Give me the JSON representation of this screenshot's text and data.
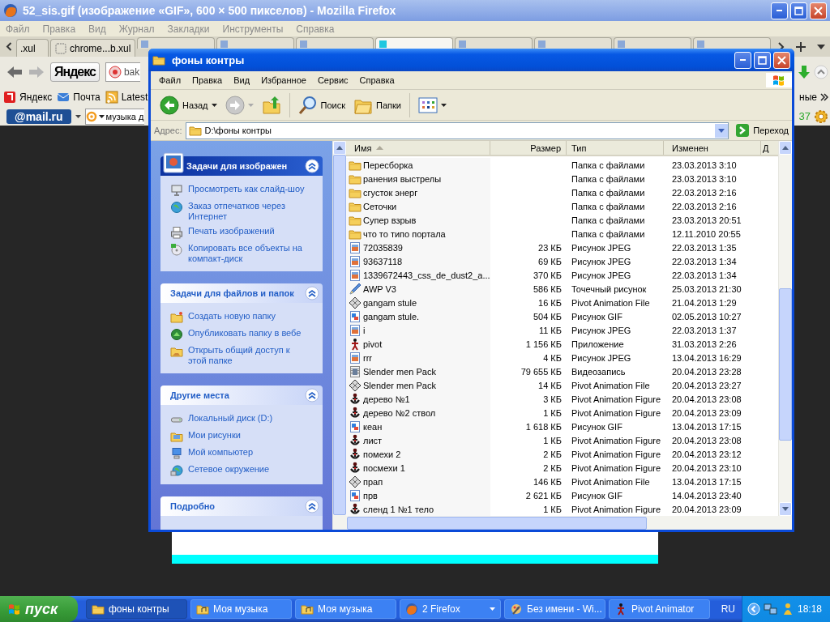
{
  "browser": {
    "title": "52_sis.gif (изображение «GIF», 600 × 500 пикселов) - Mozilla Firefox",
    "menu": [
      "Файл",
      "Правка",
      "Вид",
      "Журнал",
      "Закладки",
      "Инструменты",
      "Справка"
    ],
    "tabs": [
      {
        "label": ".xul",
        "selected": false
      },
      {
        "label": "chrome...b.xul",
        "selected": false
      },
      {
        "selected": false
      },
      {
        "selected": false
      },
      {
        "selected": false
      },
      {
        "selected": true
      },
      {
        "selected": false
      },
      {
        "selected": false
      },
      {
        "selected": false
      },
      {
        "selected": false
      }
    ],
    "search_button": "Яндекс",
    "address": "bak",
    "bookmarks": [
      "Яндекс",
      "Почта",
      "Latest"
    ],
    "bookmarks_overflow": "ные",
    "mail_logo": "@mail.ru",
    "mail_search": "музыка д",
    "counter": "37"
  },
  "explorer": {
    "title": "фоны контры",
    "menu": [
      "Файл",
      "Правка",
      "Вид",
      "Избранное",
      "Сервис",
      "Справка"
    ],
    "toolbar": {
      "back": "Назад",
      "search": "Поиск",
      "folders": "Папки"
    },
    "address_label": "Адрес:",
    "address": "D:\\фоны контры",
    "go": "Переход",
    "task_panes": [
      {
        "kind": "primary",
        "title": "Задачи для изображен",
        "expanded": true,
        "links": [
          "Просмотреть как слайд-шоу",
          "Заказ отпечатков через Интернет",
          "Печать изображений",
          "Копировать все объекты на компакт-диск"
        ]
      },
      {
        "kind": "normal",
        "title": "Задачи для файлов и папок",
        "expanded": true,
        "links": [
          "Создать новую папку",
          "Опубликовать папку в вебе",
          "Открыть общий доступ к этой папке"
        ]
      },
      {
        "kind": "normal",
        "title": "Другие места",
        "expanded": true,
        "links": [
          "Локальный диск (D:)",
          "Мои рисунки",
          "Мой компьютер",
          "Сетевое окружение"
        ]
      },
      {
        "kind": "normal",
        "title": "Подробно",
        "expanded": true
      }
    ],
    "columns": [
      "Имя",
      "Размер",
      "Тип",
      "Изменен",
      "Д"
    ],
    "files": [
      {
        "kind": "folder",
        "name": "Пересборка",
        "type": "Папка с файлами",
        "modified": "23.03.2013 3:10"
      },
      {
        "kind": "folder",
        "name": "ранения выстрелы",
        "type": "Папка с файлами",
        "modified": "23.03.2013 3:10"
      },
      {
        "kind": "folder",
        "name": "сгусток энерг",
        "type": "Папка с файлами",
        "modified": "22.03.2013 2:16"
      },
      {
        "kind": "folder",
        "name": "Сеточки",
        "type": "Папка с файлами",
        "modified": "22.03.2013 2:16"
      },
      {
        "kind": "folder",
        "name": "Супер взрыв",
        "type": "Папка с файлами",
        "modified": "23.03.2013 20:51"
      },
      {
        "kind": "folder",
        "name": "что то типо портала",
        "type": "Папка с файлами",
        "modified": "12.11.2010 20:55"
      },
      {
        "kind": "jpeg",
        "name": "72035839",
        "size": "23 КБ",
        "type": "Рисунок JPEG",
        "modified": "22.03.2013 1:35"
      },
      {
        "kind": "jpeg",
        "name": "93637118",
        "size": "69 КБ",
        "type": "Рисунок JPEG",
        "modified": "22.03.2013 1:34"
      },
      {
        "kind": "jpeg",
        "name": "1339672443_css_de_dust2_a...",
        "size": "370 КБ",
        "type": "Рисунок JPEG",
        "modified": "22.03.2013 1:34"
      },
      {
        "kind": "bitmap",
        "name": "AWP V3",
        "size": "586 КБ",
        "type": "Точечный рисунок",
        "modified": "25.03.2013 21:30"
      },
      {
        "kind": "pivot-file",
        "name": "gangam stule",
        "size": "16 КБ",
        "type": "Pivot Animation File",
        "modified": "21.04.2013 1:29"
      },
      {
        "kind": "gif",
        "name": "gangam stule.",
        "size": "504 КБ",
        "type": "Рисунок GIF",
        "modified": "02.05.2013 10:27"
      },
      {
        "kind": "jpeg",
        "name": "i",
        "size": "11 КБ",
        "type": "Рисунок JPEG",
        "modified": "22.03.2013 1:37"
      },
      {
        "kind": "application",
        "name": "pivot",
        "size": "1 156 КБ",
        "type": "Приложение",
        "modified": "31.03.2013 2:26"
      },
      {
        "kind": "jpeg",
        "name": "rrr",
        "size": "4 КБ",
        "type": "Рисунок JPEG",
        "modified": "13.04.2013 16:29"
      },
      {
        "kind": "video",
        "name": "Slender men Pack",
        "size": "79 655 КБ",
        "type": "Видеозапись",
        "modified": "20.04.2013 23:28"
      },
      {
        "kind": "pivot-file",
        "name": "Slender men Pack",
        "size": "14 КБ",
        "type": "Pivot Animation File",
        "modified": "20.04.2013 23:27"
      },
      {
        "kind": "pivot-figure",
        "name": "дерево №1",
        "size": "3 КБ",
        "type": "Pivot Animation Figure",
        "modified": "20.04.2013 23:08"
      },
      {
        "kind": "pivot-figure",
        "name": "дерево №2 ствол",
        "size": "1 КБ",
        "type": "Pivot Animation Figure",
        "modified": "20.04.2013 23:09"
      },
      {
        "kind": "gif",
        "name": "кеан",
        "size": "1 618 КБ",
        "type": "Рисунок GIF",
        "modified": "13.04.2013 17:15"
      },
      {
        "kind": "pivot-figure",
        "name": "лист",
        "size": "1 КБ",
        "type": "Pivot Animation Figure",
        "modified": "20.04.2013 23:08"
      },
      {
        "kind": "pivot-figure",
        "name": "помехи 2",
        "size": "2 КБ",
        "type": "Pivot Animation Figure",
        "modified": "20.04.2013 23:12"
      },
      {
        "kind": "pivot-figure",
        "name": "посмехи 1",
        "size": "2 КБ",
        "type": "Pivot Animation Figure",
        "modified": "20.04.2013 23:10"
      },
      {
        "kind": "pivot-file",
        "name": "прап",
        "size": "146 КБ",
        "type": "Pivot Animation File",
        "modified": "13.04.2013 17:15"
      },
      {
        "kind": "gif",
        "name": "прв",
        "size": "2 621 КБ",
        "type": "Рисунок GIF",
        "modified": "14.04.2013 23:40"
      },
      {
        "kind": "pivot-figure",
        "name": "сленд 1 №1 тело",
        "size": "1 КБ",
        "type": "Pivot Animation Figure",
        "modified": "20.04.2013 23:09"
      }
    ]
  },
  "taskbar": {
    "start": "пуск",
    "items": [
      {
        "label": "фоны контры",
        "selected": true
      },
      {
        "label": "Моя музыка",
        "selected": false
      },
      {
        "label": "Моя музыка",
        "selected": false
      },
      {
        "label": "2 Firefox",
        "selected": false
      },
      {
        "label": "Без имени - Wi...",
        "selected": false
      },
      {
        "label": "Pivot Animator",
        "selected": false
      }
    ],
    "language": "RU",
    "clock": "18:18"
  }
}
